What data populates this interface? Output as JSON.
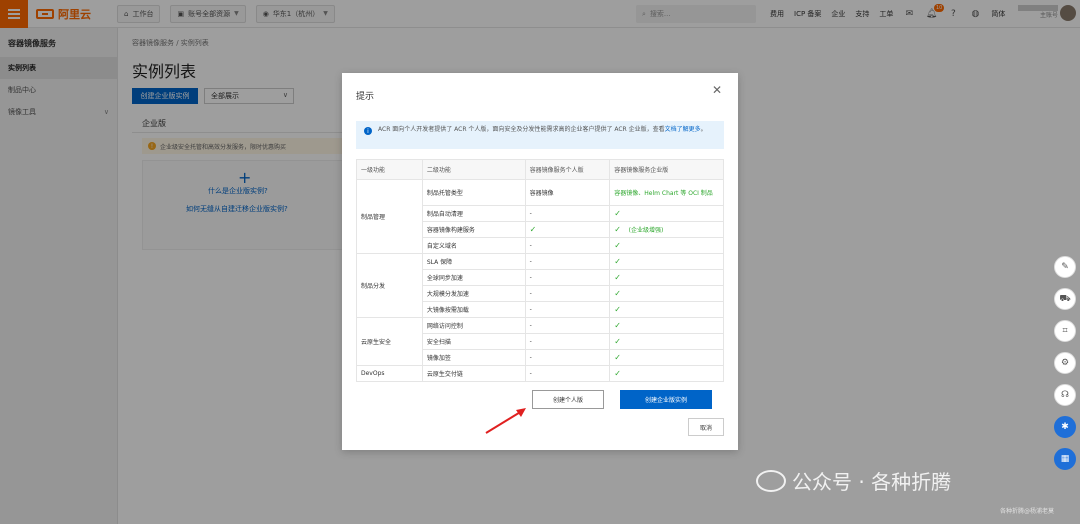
{
  "topbar": {
    "logo_text": "阿里云",
    "workbench": "工作台",
    "account": "账号全部资源",
    "region": "华东1（杭州）",
    "search_placeholder": "搜索...",
    "links": [
      "费用",
      "ICP 备案",
      "企业",
      "支持",
      "工单"
    ],
    "badge_count": "10",
    "lang": "简体",
    "user_label": "主账号"
  },
  "sidebar": {
    "title": "容器镜像服务",
    "items": [
      {
        "label": "实例列表",
        "active": true
      },
      {
        "label": "制品中心",
        "active": false
      },
      {
        "label": "镜像工具",
        "active": false,
        "has_chevron": true
      }
    ]
  },
  "main": {
    "breadcrumb": "容器镜像服务 / 实例列表",
    "title": "实例列表",
    "create_button": "创建企业版实例",
    "filter_value": "全部展示",
    "ee_label": "企业版",
    "ee_banner": "企业级安全托管和高效分发服务，限时优惠购买",
    "ee_link1": "什么是企业版实例?",
    "ee_link2": "如何无缝从自建迁移企业版实例?"
  },
  "modal": {
    "title": "提示",
    "info_text": "ACR 面向个人开发者提供了 ACR 个人版，面向安全及分发性能需求高的企业客户提供了 ACR 企业版，查看",
    "info_link": "文档了解更多",
    "info_tail": "。",
    "columns": [
      "一级功能",
      "二级功能",
      "容器镜像服务个人版",
      "容器镜像服务企业版"
    ],
    "groups": [
      {
        "name": "制品管理",
        "rows": [
          {
            "feature": "制品托管类型",
            "personal": "容器镜像",
            "enterprise": "容器镜像、Helm Chart 等 OCI 制品",
            "enterprise_green": true
          },
          {
            "feature": "制品自动清理",
            "personal": "-",
            "enterprise": "✓"
          },
          {
            "feature": "容器镜像构建服务",
            "personal": "✓",
            "enterprise": "✓",
            "enterprise_note": "(企业级增强)"
          },
          {
            "feature": "自定义域名",
            "personal": "-",
            "enterprise": "✓"
          }
        ]
      },
      {
        "name": "制品分发",
        "rows": [
          {
            "feature": "SLA 保障",
            "personal": "-",
            "enterprise": "✓"
          },
          {
            "feature": "全球同步加速",
            "personal": "-",
            "enterprise": "✓"
          },
          {
            "feature": "大规模分发加速",
            "personal": "-",
            "enterprise": "✓"
          },
          {
            "feature": "大镜像按需加载",
            "personal": "-",
            "enterprise": "✓"
          }
        ]
      },
      {
        "name": "云原生安全",
        "rows": [
          {
            "feature": "网络访问控制",
            "personal": "-",
            "enterprise": "✓"
          },
          {
            "feature": "安全扫描",
            "personal": "-",
            "enterprise": "✓"
          },
          {
            "feature": "镜像加签",
            "personal": "-",
            "enterprise": "✓"
          }
        ]
      },
      {
        "name": "DevOps",
        "rows": [
          {
            "feature": "云原生交付链",
            "personal": "-",
            "enterprise": "✓"
          }
        ]
      }
    ],
    "btn_personal": "创建个人版",
    "btn_enterprise": "创建企业版实例",
    "btn_cancel": "取消"
  },
  "watermark": {
    "text": "公众号 · 各种折腾",
    "small": "各种折腾@杨浦老莫"
  },
  "colors": {
    "brand_orange": "#ff6a00",
    "primary_blue": "#0064c8",
    "check_green": "#2fa82f"
  }
}
